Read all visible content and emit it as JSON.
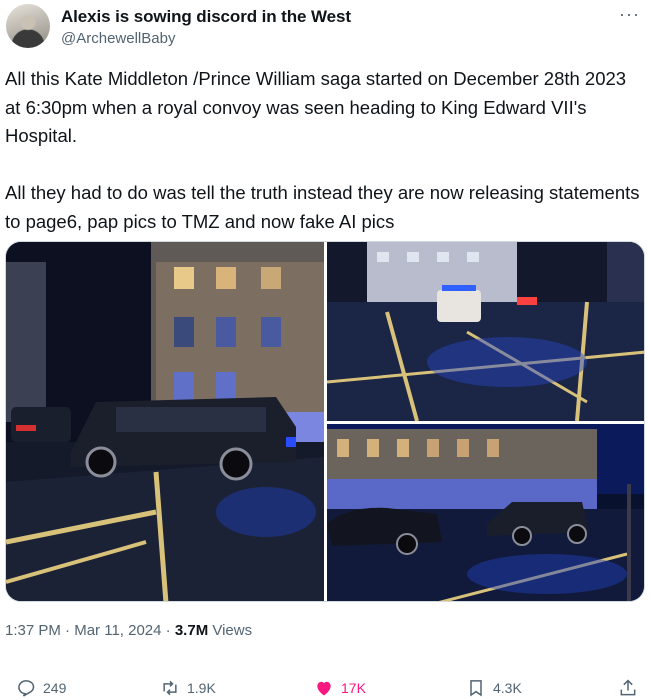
{
  "author": {
    "display_name": "Alexis is sowing discord in the West",
    "handle": "@ArchewellBaby"
  },
  "more_label": "···",
  "tweet": {
    "paragraph1": "All this Kate Middleton /Prince William saga started on December 28th 2023 at 6:30pm when a royal convoy was seen heading to King Edward VII's Hospital.",
    "paragraph2": "All they had to do was tell the truth instead they are now releasing statements to page6, pap pics to TMZ and now fake AI pics"
  },
  "meta": {
    "time": "1:37 PM",
    "separator1": " · ",
    "date": "Mar 11, 2024",
    "separator2": " · ",
    "views_count": "3.7M",
    "views_label": " Views"
  },
  "actions": {
    "replies": "249",
    "reposts": "1.9K",
    "likes": "17K",
    "bookmarks": "4.3K"
  },
  "icons": [
    "reply-icon",
    "repost-icon",
    "like-icon",
    "bookmark-icon",
    "share-icon",
    "more-icon"
  ],
  "colors": {
    "like_active": "#f91880",
    "secondary_text": "#536471",
    "primary_text": "#0f1419"
  }
}
